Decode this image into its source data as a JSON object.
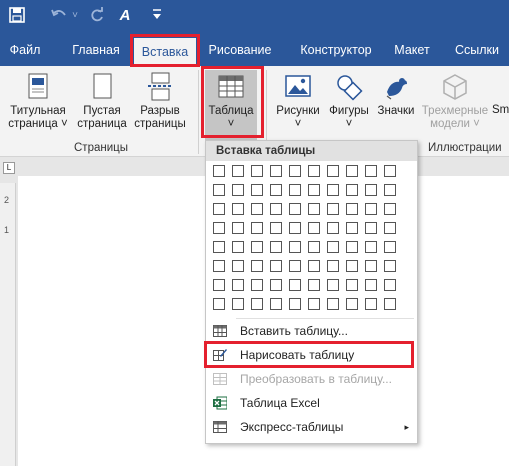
{
  "quick_access": {
    "icons": [
      "save-icon",
      "undo-icon",
      "redo-icon",
      "format-painter-icon",
      "customize-icon"
    ]
  },
  "tabs": [
    "Файл",
    "Главная",
    "Вставка",
    "Рисование",
    "Конструктор",
    "Макет",
    "Ссылки"
  ],
  "active_tab": "Вставка",
  "ribbon": {
    "pages_group": {
      "label": "Страницы",
      "buttons": [
        {
          "line1": "Титульная",
          "line2": "страница ˅"
        },
        {
          "line1": "Пустая",
          "line2": "страница"
        },
        {
          "line1": "Разрыв",
          "line2": "страницы"
        }
      ]
    },
    "table_button": {
      "line1": "Таблица",
      "line2": "˅"
    },
    "illustrations_group": {
      "label": "Иллюстрации",
      "buttons": [
        {
          "line1": "Рисунки",
          "line2": "˅"
        },
        {
          "line1": "Фигуры",
          "line2": "˅"
        },
        {
          "line1": "Значки",
          "line2": ""
        },
        {
          "line1": "Трехмерные",
          "line2": "модели ˅"
        },
        {
          "line1": "Sm",
          "line2": ""
        }
      ]
    }
  },
  "ruler": {
    "box_glyph": "L",
    "marks": [
      "2",
      "1"
    ]
  },
  "dropdown": {
    "header": "Вставка таблицы",
    "grid": {
      "cols": 10,
      "rows": 8
    },
    "items": [
      {
        "label": "Вставить таблицу...",
        "icon": "table-icon",
        "enabled": true
      },
      {
        "label": "Нарисовать таблицу",
        "icon": "draw-table-icon",
        "enabled": true
      },
      {
        "label": "Преобразовать в таблицу...",
        "icon": "convert-table-icon",
        "enabled": false
      },
      {
        "label": "Таблица Excel",
        "icon": "excel-icon",
        "enabled": true
      },
      {
        "label": "Экспресс-таблицы",
        "icon": "quick-tables-icon",
        "enabled": true,
        "submenu_arrow": "▸"
      }
    ]
  },
  "colors": {
    "ribbon_blue": "#2b579a",
    "highlight_red": "#e4202e",
    "excel_green": "#1d6f42"
  }
}
